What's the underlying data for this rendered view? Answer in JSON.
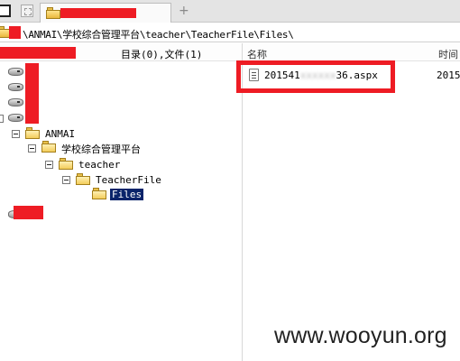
{
  "address": {
    "path": "\\ANMAI\\学校综合管理平台\\teacher\\TeacherFile\\Files\\"
  },
  "tree_header": {
    "summary": "目录(0),文件(1)"
  },
  "columns": {
    "name": "名称",
    "time": "时间"
  },
  "tree": {
    "nodes": [
      {
        "label": "ANMAI"
      },
      {
        "label": "学校综合管理平台"
      },
      {
        "label": "teacher"
      },
      {
        "label": "TeacherFile"
      },
      {
        "label": "Files"
      }
    ]
  },
  "files": [
    {
      "name_prefix": "201541",
      "name_blurred": "xxxxxx",
      "name_suffix": "36.aspx",
      "time": "2015-"
    }
  ],
  "watermark": "www.wooyun.org",
  "colors": {
    "redaction": "#ee1c24",
    "selection": "#0a246a"
  }
}
